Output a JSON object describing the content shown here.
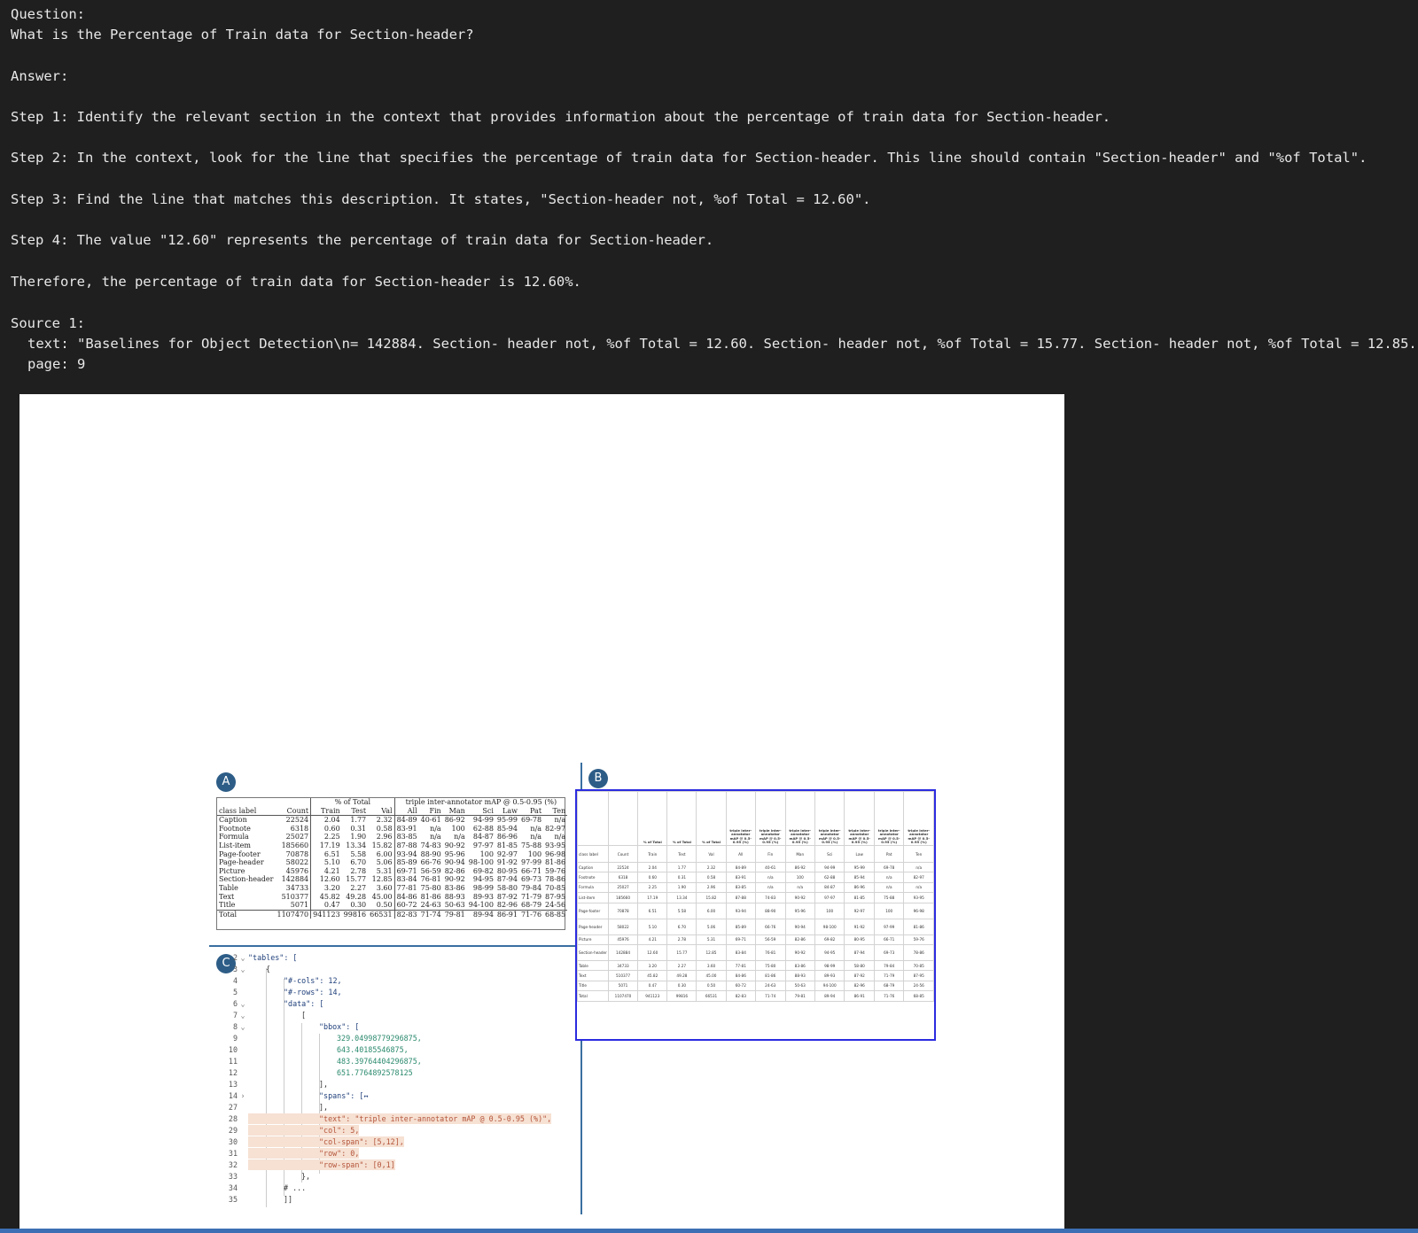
{
  "transcript": {
    "question_label": "Question:",
    "question": "What is the Percentage of Train data for Section-header?",
    "answer_label": "Answer:",
    "steps": [
      "Step 1: Identify the relevant section in the context that provides information about the percentage of train data for Section-header.",
      "Step 2: In the context, look for the line that specifies the percentage of train data for Section-header. This line should contain \"Section-header\" and \"%of Total\".",
      "Step 3: Find the line that matches this description. It states, \"Section-header not, %of Total = 12.60\".",
      "Step 4: The value \"12.60\" represents the percentage of train data for Section-header."
    ],
    "conclusion": "Therefore, the percentage of train data for Section-header is 12.60%.",
    "source_label": "Source 1:",
    "source_text": "text: \"Baselines for Object Detection\\n= 142884. Section- header not, %of Total = 12.60. Section- header not, %of Total = 15.77. Section- header not, %of Total = 12.85.",
    "source_page": "page: 9"
  },
  "figure": {
    "badge_a": "A",
    "badge_b": "B",
    "badge_c": "C",
    "table_a": {
      "group_pct": "% of Total",
      "group_map": "triple inter-annotator mAP @ 0.5-0.95 (%)",
      "columns": [
        "class label",
        "Count",
        "Train",
        "Test",
        "Val",
        "All",
        "Fin",
        "Man",
        "Sci",
        "Law",
        "Pat",
        "Ten"
      ],
      "rows": [
        [
          "Caption",
          "22524",
          "2.04",
          "1.77",
          "2.32",
          "84-89",
          "40-61",
          "86-92",
          "94-99",
          "95-99",
          "69-78",
          "n/a"
        ],
        [
          "Footnote",
          "6318",
          "0.60",
          "0.31",
          "0.58",
          "83-91",
          "n/a",
          "100",
          "62-88",
          "85-94",
          "n/a",
          "82-97"
        ],
        [
          "Formula",
          "25027",
          "2.25",
          "1.90",
          "2.96",
          "83-85",
          "n/a",
          "n/a",
          "84-87",
          "86-96",
          "n/a",
          "n/a"
        ],
        [
          "List-item",
          "185660",
          "17.19",
          "13.34",
          "15.82",
          "87-88",
          "74-83",
          "90-92",
          "97-97",
          "81-85",
          "75-88",
          "93-95"
        ],
        [
          "Page-footer",
          "70878",
          "6.51",
          "5.58",
          "6.00",
          "93-94",
          "88-90",
          "95-96",
          "100",
          "92-97",
          "100",
          "96-98"
        ],
        [
          "Page-header",
          "58022",
          "5.10",
          "6.70",
          "5.06",
          "85-89",
          "66-76",
          "90-94",
          "98-100",
          "91-92",
          "97-99",
          "81-86"
        ],
        [
          "Picture",
          "45976",
          "4.21",
          "2.78",
          "5.31",
          "69-71",
          "56-59",
          "82-86",
          "69-82",
          "80-95",
          "66-71",
          "59-76"
        ],
        [
          "Section-header",
          "142884",
          "12.60",
          "15.77",
          "12.85",
          "83-84",
          "76-81",
          "90-92",
          "94-95",
          "87-94",
          "69-73",
          "78-86"
        ],
        [
          "Table",
          "34733",
          "3.20",
          "2.27",
          "3.60",
          "77-81",
          "75-80",
          "83-86",
          "98-99",
          "58-80",
          "79-84",
          "70-85"
        ],
        [
          "Text",
          "510377",
          "45.82",
          "49.28",
          "45.00",
          "84-86",
          "81-86",
          "88-93",
          "89-93",
          "87-92",
          "71-79",
          "87-95"
        ],
        [
          "Title",
          "5071",
          "0.47",
          "0.30",
          "0.50",
          "60-72",
          "24-63",
          "50-63",
          "94-100",
          "82-96",
          "68-79",
          "24-56"
        ],
        [
          "Total",
          "1107470",
          "941123",
          "99816",
          "66531",
          "82-83",
          "71-74",
          "79-81",
          "89-94",
          "86-91",
          "71-76",
          "68-85"
        ]
      ]
    },
    "table_b": {
      "header_pct": "% of Total",
      "header_map": "triple inter-annotator mAP @ 0.5-0.95 (%)",
      "columns": [
        "class label",
        "Count",
        "Train",
        "Test",
        "Val",
        "All",
        "Fin",
        "Man",
        "Sci",
        "Law",
        "Pat",
        "Ten"
      ]
    },
    "code": [
      {
        "ln": "2",
        "fold": "⌄",
        "text": "\"tables\": ["
      },
      {
        "ln": "3",
        "fold": "⌄",
        "text": "{"
      },
      {
        "ln": "4",
        "fold": "",
        "text": "\"#-cols\": 12,"
      },
      {
        "ln": "5",
        "fold": "",
        "text": "\"#-rows\": 14,"
      },
      {
        "ln": "6",
        "fold": "⌄",
        "text": "\"data\": ["
      },
      {
        "ln": "7",
        "fold": "⌄",
        "text": "["
      },
      {
        "ln": "8",
        "fold": "⌄",
        "text": "\"bbox\": ["
      },
      {
        "ln": "9",
        "fold": "",
        "text": "329.04998779296875,"
      },
      {
        "ln": "10",
        "fold": "",
        "text": "643.40185546875,"
      },
      {
        "ln": "11",
        "fold": "",
        "text": "483.39764404296875,"
      },
      {
        "ln": "12",
        "fold": "",
        "text": "651.7764892578125"
      },
      {
        "ln": "13",
        "fold": "",
        "text": "],"
      },
      {
        "ln": "14",
        "fold": "›",
        "text": "\"spans\": [↔"
      },
      {
        "ln": "27",
        "fold": "",
        "text": "],"
      },
      {
        "ln": "28",
        "fold": "",
        "text": "\"text\": \"triple inter-annotator mAP @ 0.5-0.95 (%)\","
      },
      {
        "ln": "29",
        "fold": "",
        "text": "\"col\": 5,"
      },
      {
        "ln": "30",
        "fold": "",
        "text": "\"col-span\": [5,12],"
      },
      {
        "ln": "31",
        "fold": "",
        "text": "\"row\": 0,"
      },
      {
        "ln": "32",
        "fold": "",
        "text": "\"row-span\": [0,1]"
      },
      {
        "ln": "33",
        "fold": "",
        "text": "},"
      },
      {
        "ln": "34",
        "fold": "",
        "text": "# ..."
      },
      {
        "ln": "35",
        "fold": "",
        "text": "]]"
      }
    ]
  }
}
